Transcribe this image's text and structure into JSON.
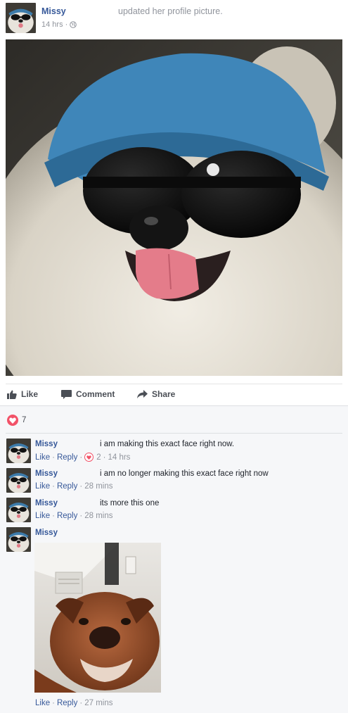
{
  "post": {
    "author": "Missy",
    "action": "updated her profile picture.",
    "time": "14 hrs",
    "separator": "·"
  },
  "actions": {
    "like": "Like",
    "comment": "Comment",
    "share": "Share"
  },
  "reactions": {
    "count": "7"
  },
  "comments": [
    {
      "author": "Missy",
      "text": "i am making this exact face right now.",
      "like": "Like",
      "reply": "Reply",
      "reaction_count": "2",
      "time": "14 hrs"
    },
    {
      "author": "Missy",
      "text": "i am no longer making this exact face right now",
      "like": "Like",
      "reply": "Reply",
      "time": "28 mins"
    },
    {
      "author": "Missy",
      "text": "its more this one",
      "like": "Like",
      "reply": "Reply",
      "time": "28 mins"
    },
    {
      "author": "Missy",
      "text": "",
      "like": "Like",
      "reply": "Reply",
      "time": "27 mins"
    }
  ],
  "colors": {
    "link_blue": "#365899",
    "meta_gray": "#90949c",
    "reaction_red": "#f25268",
    "comments_bg": "#f6f7f9"
  },
  "icons": [
    "globe-icon",
    "thumbs-up-icon",
    "speech-bubble-icon",
    "share-arrow-icon",
    "heart-icon"
  ]
}
